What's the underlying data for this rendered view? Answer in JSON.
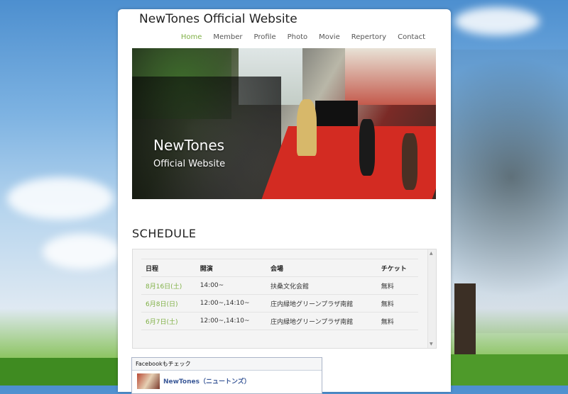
{
  "site": {
    "title": "NewTones Official Website"
  },
  "nav": {
    "items": [
      {
        "label": "Home",
        "active": true
      },
      {
        "label": "Member"
      },
      {
        "label": "Profile"
      },
      {
        "label": "Photo"
      },
      {
        "label": "Movie"
      },
      {
        "label": "Repertory"
      },
      {
        "label": "Contact"
      }
    ]
  },
  "hero": {
    "title": "NewTones",
    "subtitle": "Official Website"
  },
  "schedule": {
    "title": "SCHEDULE",
    "columns": [
      "日程",
      "開演",
      "会場",
      "チケット"
    ],
    "rows": [
      {
        "date": "8月16日(土)",
        "time": "14:00~",
        "venue": "扶桑文化会館",
        "ticket": "無料"
      },
      {
        "date": "6月8日(日)",
        "time": "12:00~,14:10~",
        "venue": "庄内緑地グリーンプラザ南館",
        "ticket": "無料"
      },
      {
        "date": "6月7日(土)",
        "time": "12:00~,14:10~",
        "venue": "庄内緑地グリーンプラザ南館",
        "ticket": "無料"
      }
    ]
  },
  "facebook": {
    "header": "Facebookもチェック",
    "page_name": "NewTones（ニュートンズ）"
  },
  "colors": {
    "accent": "#7fb045",
    "facebook_link": "#3b5998"
  }
}
